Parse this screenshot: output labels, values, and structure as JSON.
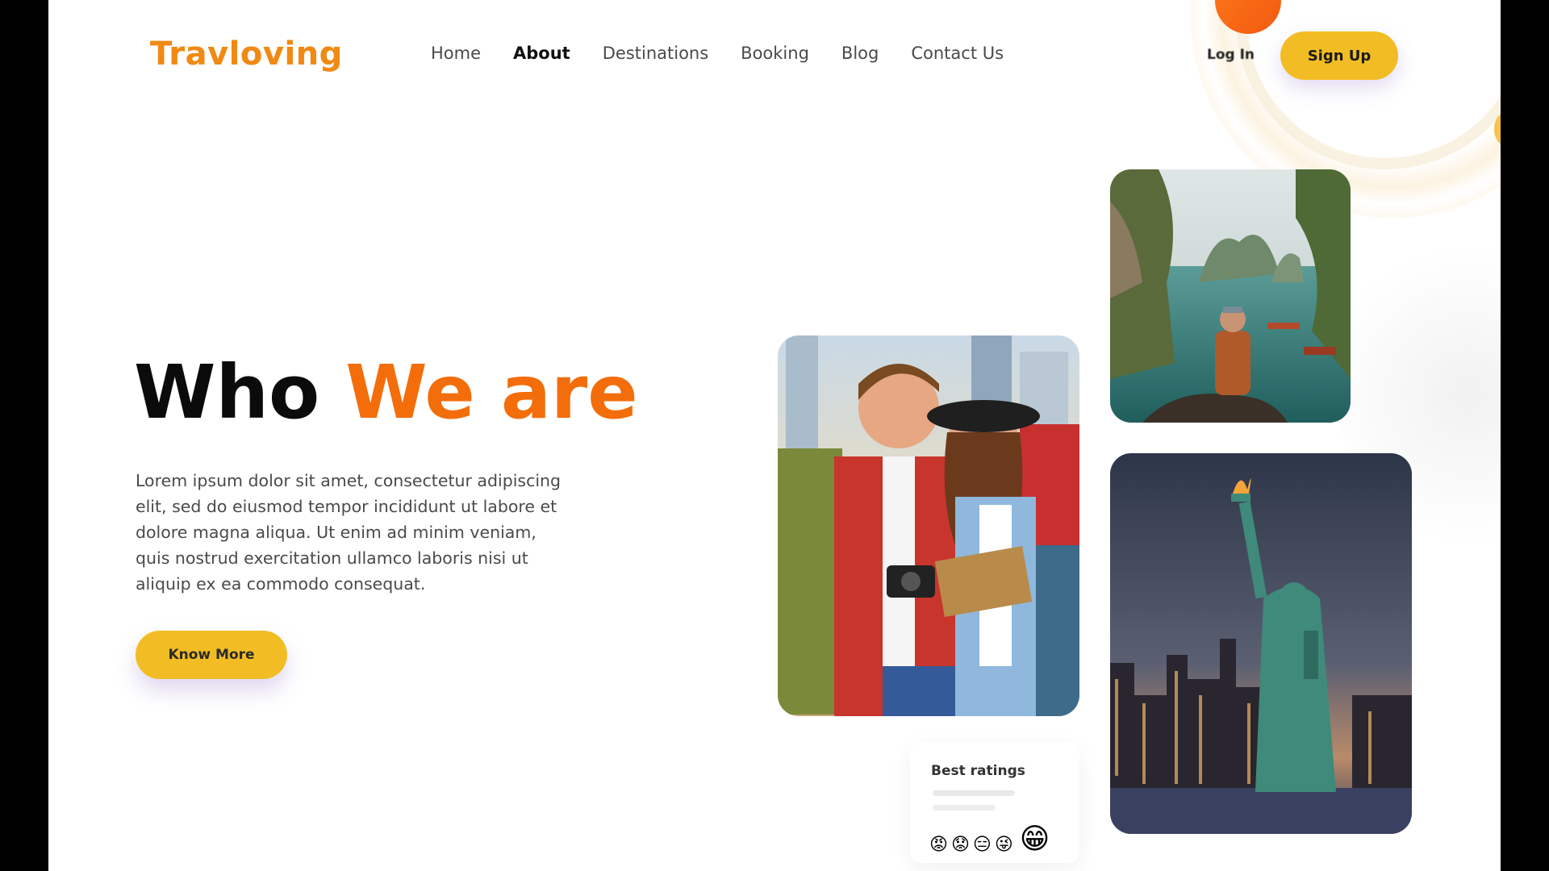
{
  "brand": {
    "logo_text": "Travloving",
    "accent_color": "#f36d0a",
    "button_color": "#f2bd24"
  },
  "nav": {
    "items": [
      {
        "label": "Home",
        "active": false
      },
      {
        "label": "About",
        "active": true
      },
      {
        "label": "Destinations",
        "active": false
      },
      {
        "label": "Booking",
        "active": false
      },
      {
        "label": "Blog",
        "active": false
      },
      {
        "label": "Contact Us",
        "active": false
      }
    ]
  },
  "auth": {
    "login_label": "Log In",
    "signup_label": "Sign Up"
  },
  "hero": {
    "title_part1": "Who",
    "title_part2": "We are",
    "body": "Lorem ipsum dolor sit amet, consectetur adipiscing elit, sed do eiusmod tempor incididunt ut labore et dolore magna aliqua. Ut enim ad minim veniam, quis nostrud exercitation ullamco laboris nisi ut aliquip ex ea commodo consequat.",
    "cta_label": "Know More"
  },
  "ratings": {
    "title": "Best ratings",
    "emojis": [
      "😡",
      "😟",
      "😑",
      "😜",
      "😁"
    ]
  },
  "images": {
    "couple": "travelers-couple-photo",
    "bay": "bay-with-hiker-photo",
    "liberty": "statue-of-liberty-photo"
  }
}
